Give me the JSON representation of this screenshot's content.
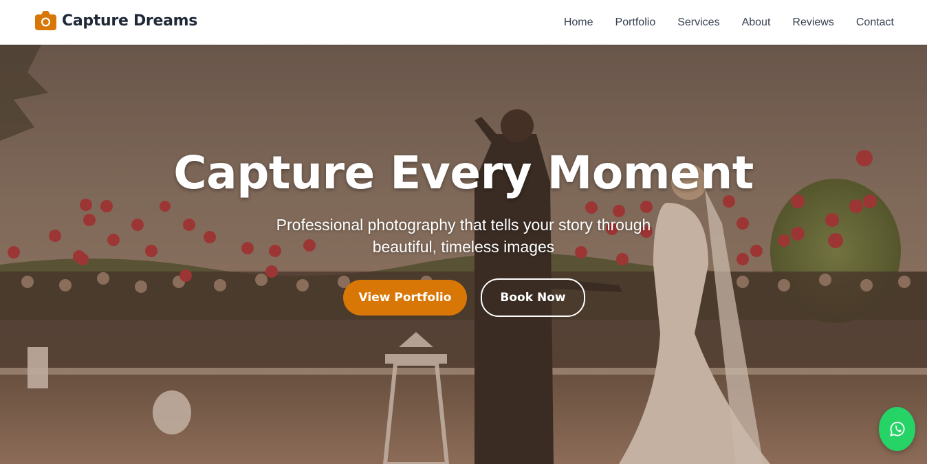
{
  "brand": {
    "name": "Capture Dreams",
    "icon": "camera-icon",
    "color": "#d97706"
  },
  "nav": {
    "items": [
      {
        "label": "Home"
      },
      {
        "label": "Portfolio"
      },
      {
        "label": "Services"
      },
      {
        "label": "About"
      },
      {
        "label": "Reviews"
      },
      {
        "label": "Contact"
      }
    ]
  },
  "hero": {
    "title": "Capture Every Moment",
    "subtitle": "Professional photography that tells your story through beautiful, timeless images",
    "primary_button": "View Portfolio",
    "secondary_button": "Book Now",
    "background_image": "wedding-couple-red-balloons-photo"
  },
  "whatsapp": {
    "icon": "whatsapp-icon",
    "color": "#25d366"
  }
}
